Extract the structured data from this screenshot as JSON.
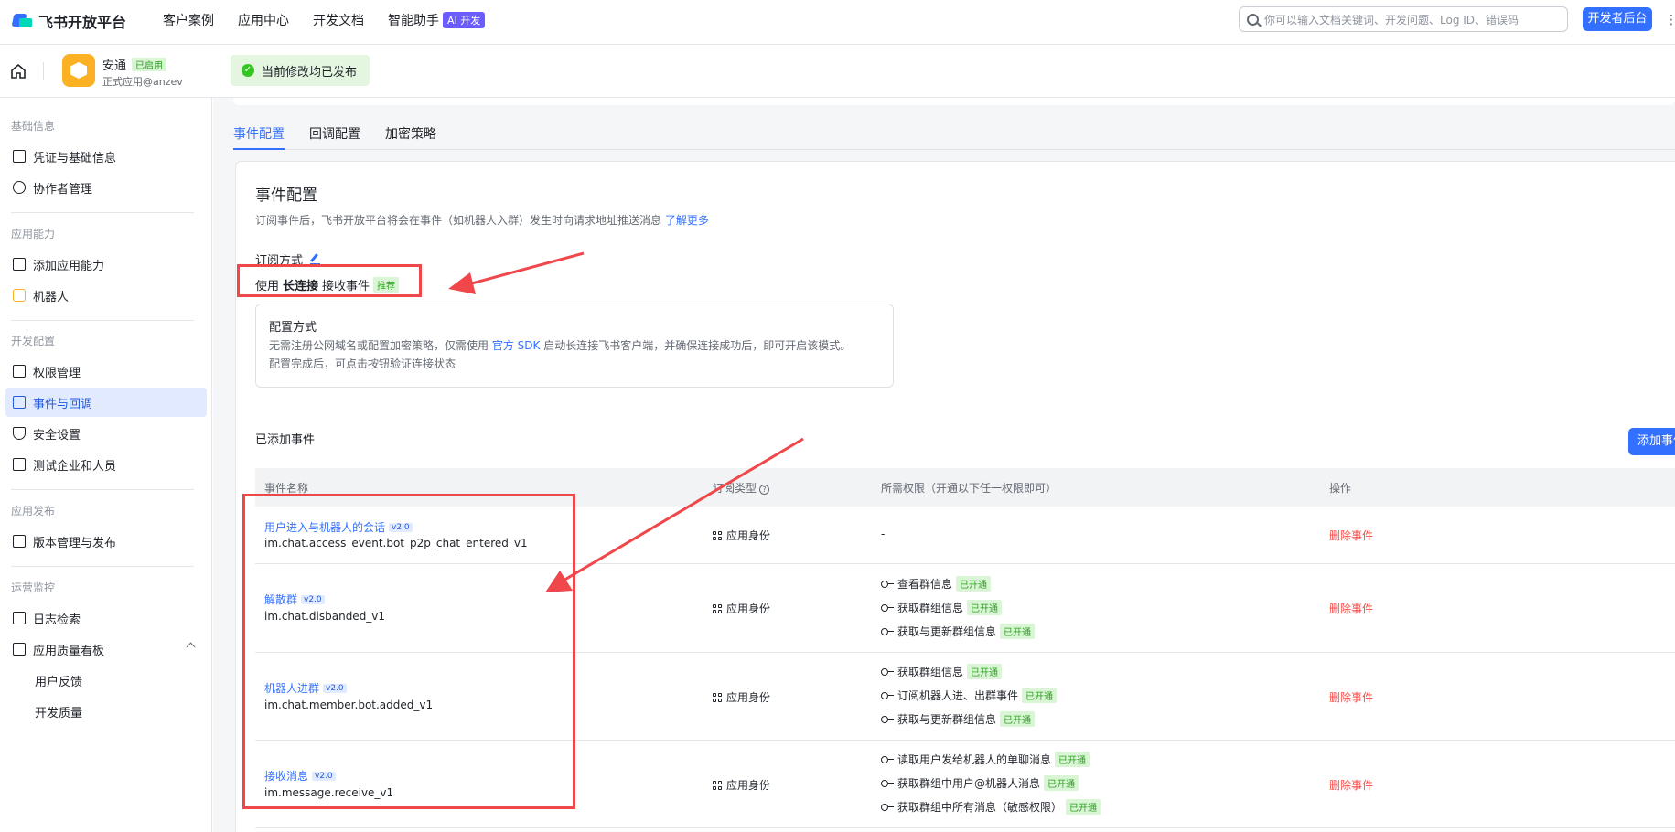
{
  "header": {
    "logo_text": "飞书开放平台",
    "nav": [
      "客户案例",
      "应用中心",
      "开发文档",
      "智能助手"
    ],
    "ai_badge": "AI 开发",
    "search_placeholder": "你可以输入文档关键词、开发问题、Log ID、错误码",
    "dev_console_label": "开发者后台"
  },
  "app": {
    "name": "安通",
    "status": "已启用",
    "subtitle": "正式应用@anzev",
    "publish_notice": "当前修改均已发布"
  },
  "sidebar": {
    "sections": [
      {
        "title": "基础信息",
        "items": [
          {
            "label": "凭证与基础信息",
            "icon": "credential-icon"
          },
          {
            "label": "协作者管理",
            "icon": "user-icon"
          }
        ]
      },
      {
        "title": "应用能力",
        "items": [
          {
            "label": "添加应用能力",
            "icon": "grid-add-icon"
          },
          {
            "label": "机器人",
            "icon": "robot-icon"
          }
        ]
      },
      {
        "title": "开发配置",
        "items": [
          {
            "label": "权限管理",
            "icon": "lock-icon"
          },
          {
            "label": "事件与回调",
            "icon": "event-icon",
            "active": true
          },
          {
            "label": "安全设置",
            "icon": "shield-icon"
          },
          {
            "label": "测试企业和人员",
            "icon": "code-icon"
          }
        ]
      },
      {
        "title": "应用发布",
        "items": [
          {
            "label": "版本管理与发布",
            "icon": "upload-icon"
          }
        ]
      },
      {
        "title": "运营监控",
        "items": [
          {
            "label": "日志检索",
            "icon": "log-icon"
          },
          {
            "label": "应用质量看板",
            "icon": "chart-icon"
          },
          {
            "label": "用户反馈"
          },
          {
            "label": "开发质量"
          }
        ]
      }
    ]
  },
  "tabs": [
    "事件配置",
    "回调配置",
    "加密策略"
  ],
  "event_config": {
    "title": "事件配置",
    "desc_prefix": "订阅事件后，飞书开放平台将会在事件（如机器人入群）发生时向请求地址推送消息",
    "desc_link": "了解更多",
    "sub_label": "订阅方式",
    "mode_prefix": "使用",
    "mode_bold": "长连接",
    "mode_suffix": "接收事件",
    "mode_tag": "推荐",
    "config_box": {
      "title": "配置方式",
      "line1_prefix": "无需注册公网域名或配置加密策略，仅需使用",
      "line1_link": "官方 SDK",
      "line1_suffix": "启动长连接飞书客户端，并确保连接成功后，即可开启该模式。",
      "line2": "配置完成后，可点击按钮验证连接状态"
    },
    "added_label": "已添加事件",
    "add_button": "添加事件",
    "columns": [
      "事件名称",
      "订阅类型",
      "所需权限（开通以下任一权限即可）",
      "操作"
    ],
    "rows": [
      {
        "name": "用户进入与机器人的会话",
        "version": "v2.0",
        "code": "im.chat.access_event.bot_p2p_chat_entered_v1",
        "type": "应用身份",
        "perm_none": "-",
        "perms": [],
        "op": "删除事件"
      },
      {
        "name": "解散群",
        "version": "v2.0",
        "code": "im.chat.disbanded_v1",
        "type": "应用身份",
        "perms": [
          {
            "label": "查看群信息",
            "tag": "已开通"
          },
          {
            "label": "获取群组信息",
            "tag": "已开通"
          },
          {
            "label": "获取与更新群组信息",
            "tag": "已开通"
          }
        ],
        "op": "删除事件"
      },
      {
        "name": "机器人进群",
        "version": "v2.0",
        "code": "im.chat.member.bot.added_v1",
        "type": "应用身份",
        "perms": [
          {
            "label": "获取群组信息",
            "tag": "已开通"
          },
          {
            "label": "订阅机器人进、出群事件",
            "tag": "已开通"
          },
          {
            "label": "获取与更新群组信息",
            "tag": "已开通"
          }
        ],
        "op": "删除事件"
      },
      {
        "name": "接收消息",
        "version": "v2.0",
        "code": "im.message.receive_v1",
        "type": "应用身份",
        "perms": [
          {
            "label": "读取用户发给机器人的单聊消息",
            "tag": "已开通"
          },
          {
            "label": "获取群组中用户@机器人消息",
            "tag": "已开通"
          },
          {
            "label": "获取群组中所有消息（敏感权限）",
            "tag": "已开通"
          }
        ],
        "op": "删除事件"
      }
    ]
  },
  "annotation_color": "#f0474b"
}
